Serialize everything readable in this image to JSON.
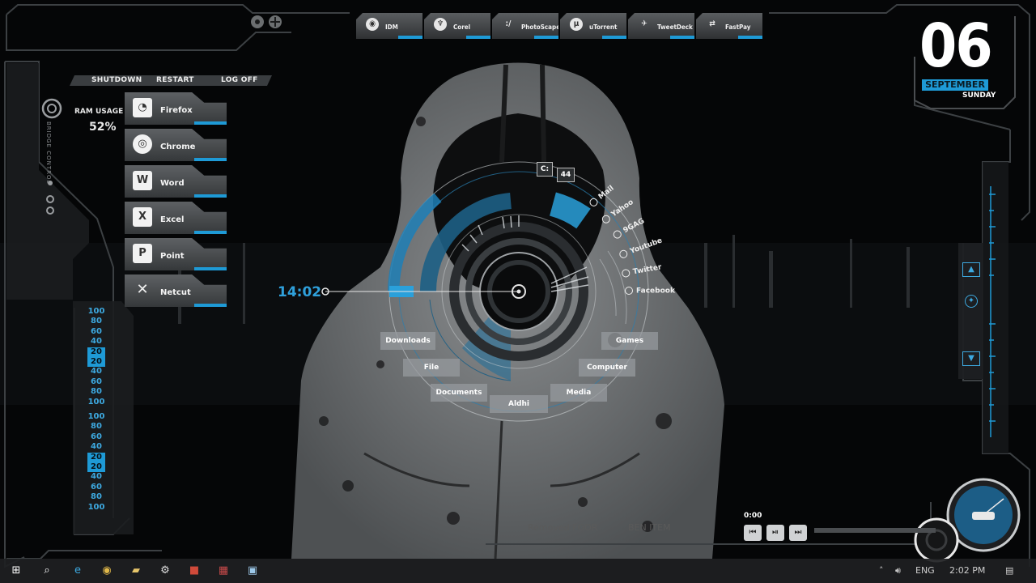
{
  "top_apps": [
    {
      "label": "IDM",
      "icon": "idm-icon"
    },
    {
      "label": "Corel",
      "icon": "corel-icon"
    },
    {
      "label": "PhotoScape",
      "icon": "photoscape-icon"
    },
    {
      "label": "uTorrent",
      "icon": "utorrent-icon"
    },
    {
      "label": "TweetDeck",
      "icon": "tweetdeck-icon"
    },
    {
      "label": "FastPay",
      "icon": "fastpay-icon"
    }
  ],
  "power": {
    "shutdown": "SHUTDOWN",
    "restart": "RESTART",
    "logoff": "LOG OFF"
  },
  "ram": {
    "label": "RAM USAGE",
    "value": "52%"
  },
  "side_title": "BRIDGE CONTROL",
  "left_apps": [
    {
      "label": "Firefox",
      "icon": "firefox-icon"
    },
    {
      "label": "Chrome",
      "icon": "chrome-icon"
    },
    {
      "label": "Word",
      "icon": "word-icon"
    },
    {
      "label": "Excel",
      "icon": "excel-icon"
    },
    {
      "label": "Point",
      "icon": "powerpoint-icon"
    },
    {
      "label": "Netcut",
      "icon": "netcut-icon"
    }
  ],
  "scale_top": [
    "100",
    "80",
    "60",
    "40",
    "20",
    "20",
    "40",
    "60",
    "80",
    "100"
  ],
  "scale_bottom": [
    "100",
    "80",
    "60",
    "40",
    "20",
    "20",
    "40",
    "60",
    "80",
    "100"
  ],
  "date": {
    "day": "06",
    "month": "SEPTEMBER",
    "weekday": "SUNDAY"
  },
  "clock": {
    "time": "14:02"
  },
  "indicators": {
    "drive": "C:",
    "count": "44"
  },
  "web_links": [
    "Mail",
    "Yahoo",
    "9GAG",
    "Youtube",
    "Twitter",
    "Facebook"
  ],
  "folders": {
    "downloads": "Downloads",
    "file": "File",
    "documents": "Documents",
    "aldhi": "Aldhi",
    "media": "Media",
    "computer": "Computer",
    "games": "Games"
  },
  "media": {
    "time": "0:00",
    "status_left": "Removed FOOR",
    "status_right": "BEN ITEM"
  },
  "tray": {
    "lang": "ENG",
    "time": "2:02 PM"
  },
  "colors": {
    "accent": "#1e9ad6",
    "panel": "#3a3d40",
    "background": "#050607"
  }
}
